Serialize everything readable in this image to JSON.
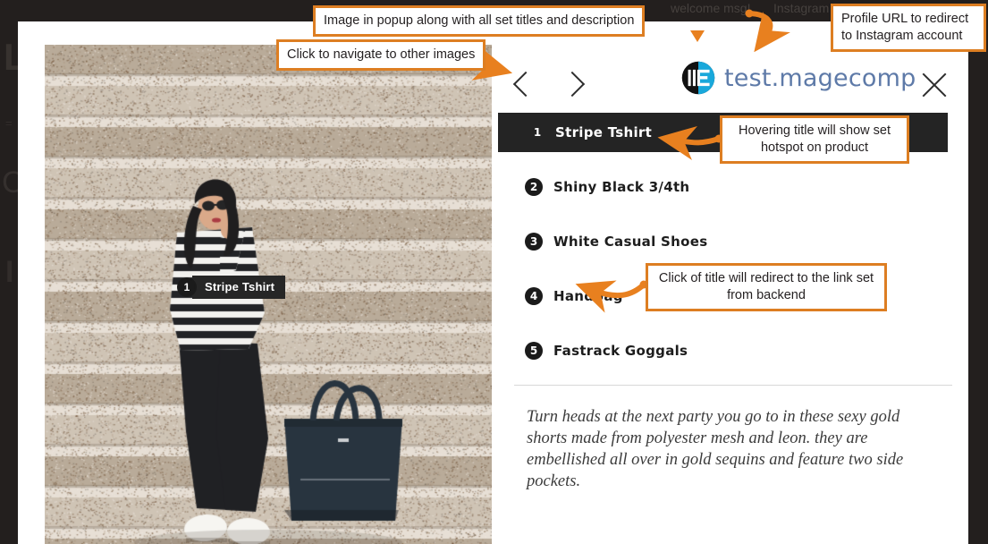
{
  "background_page": {
    "nav_welcome": "welcome msg!",
    "nav_instagram": "Instagram",
    "logo_text": "L",
    "menu_text": "=",
    "category_text": "Ca",
    "footer_text": "I"
  },
  "popup": {
    "brand_name": "test.magecomp",
    "brand_logo_icon": "magecomp-logo-icon",
    "prev_icon": "chevron-left-icon",
    "next_icon": "chevron-right-icon",
    "close_icon": "close-icon",
    "hotspot": {
      "number": "1",
      "label": "Stripe Tshirt"
    },
    "products": [
      {
        "number": "1",
        "title": "Stripe Tshirt",
        "active": true
      },
      {
        "number": "2",
        "title": "Shiny Black 3/4th",
        "active": false
      },
      {
        "number": "3",
        "title": "White Casual Shoes",
        "active": false
      },
      {
        "number": "4",
        "title": "Handbag",
        "active": false
      },
      {
        "number": "5",
        "title": "Fastrack Goggals",
        "active": false
      }
    ],
    "description": "Turn heads at the next party you go to in these sexy gold shorts made from polyester mesh and leon. they are embellished all over in gold sequins and feature two side pockets."
  },
  "annotations": {
    "image_popup": "Image in popup along with all set titles and description",
    "navigate": "Click to navigate to other images",
    "profile_url": "Profile URL to redirect to Instagram account",
    "hover_title": "Hovering title will show set hotspot on product",
    "click_title": "Click of title will redirect to the link set from backend"
  },
  "colors": {
    "annotation_border": "#dd7e22",
    "annotation_arrow": "#e8801f",
    "brand_text": "#5e7aa8",
    "active_row_bg": "#242424",
    "overlay_bg": "#231f1e"
  }
}
